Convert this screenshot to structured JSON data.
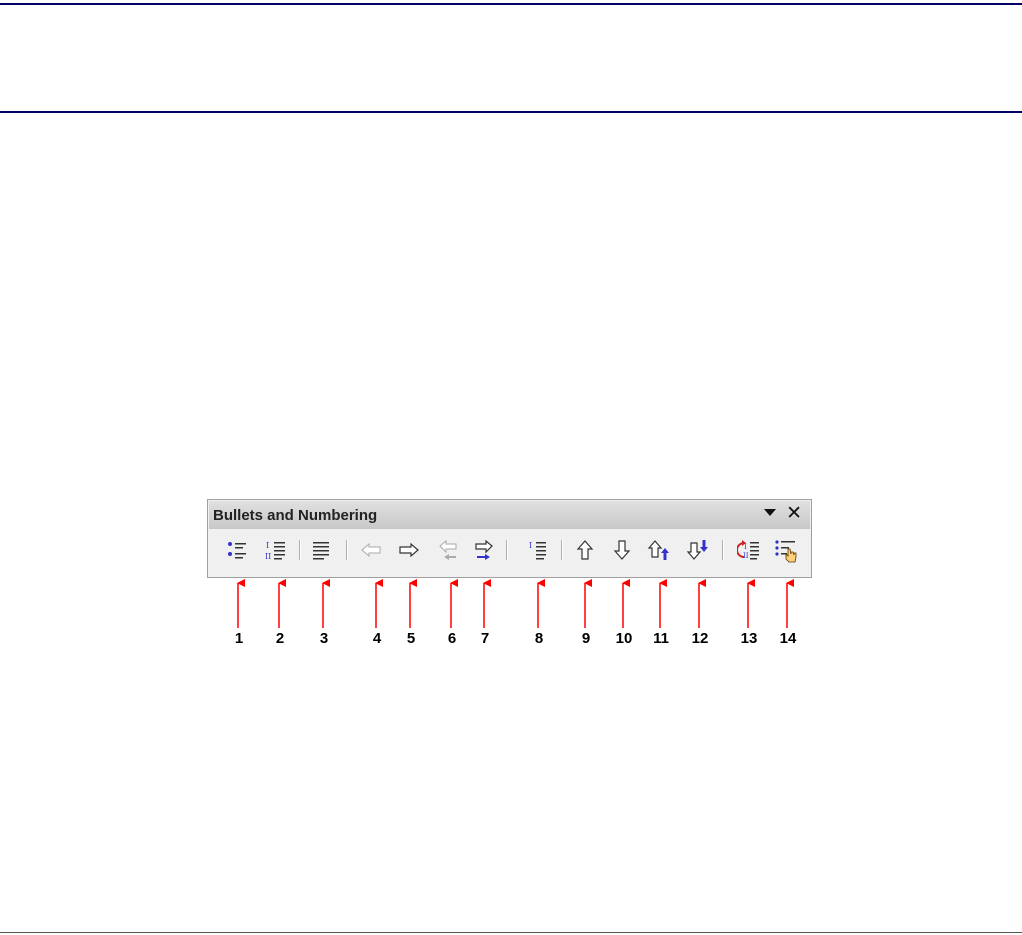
{
  "toolbar": {
    "title": "Bullets and Numbering",
    "dropdown_icon": "triangle-down-icon",
    "close_glyph": "✕",
    "buttons": [
      {
        "icon": "bullets-list-icon"
      },
      {
        "icon": "numbered-list-icon"
      },
      {
        "icon": "no-list-icon"
      },
      {
        "icon": "promote-one-level-icon"
      },
      {
        "icon": "demote-one-level-icon"
      },
      {
        "icon": "promote-with-subpoints-icon"
      },
      {
        "icon": "demote-with-subpoints-icon"
      },
      {
        "icon": "insert-unnumbered-entry-icon"
      },
      {
        "icon": "move-up-icon"
      },
      {
        "icon": "move-down-icon"
      },
      {
        "icon": "move-up-with-subpoints-icon"
      },
      {
        "icon": "move-down-with-subpoints-icon"
      },
      {
        "icon": "restart-numbering-icon"
      },
      {
        "icon": "bullets-and-numbering-dialog-icon"
      }
    ]
  },
  "callouts": [
    "1",
    "2",
    "3",
    "4",
    "5",
    "6",
    "7",
    "8",
    "9",
    "10",
    "11",
    "12",
    "13",
    "14"
  ],
  "colors": {
    "arrow": "#ff0000",
    "rule": "#000066",
    "icon_blue": "#3333cc"
  }
}
